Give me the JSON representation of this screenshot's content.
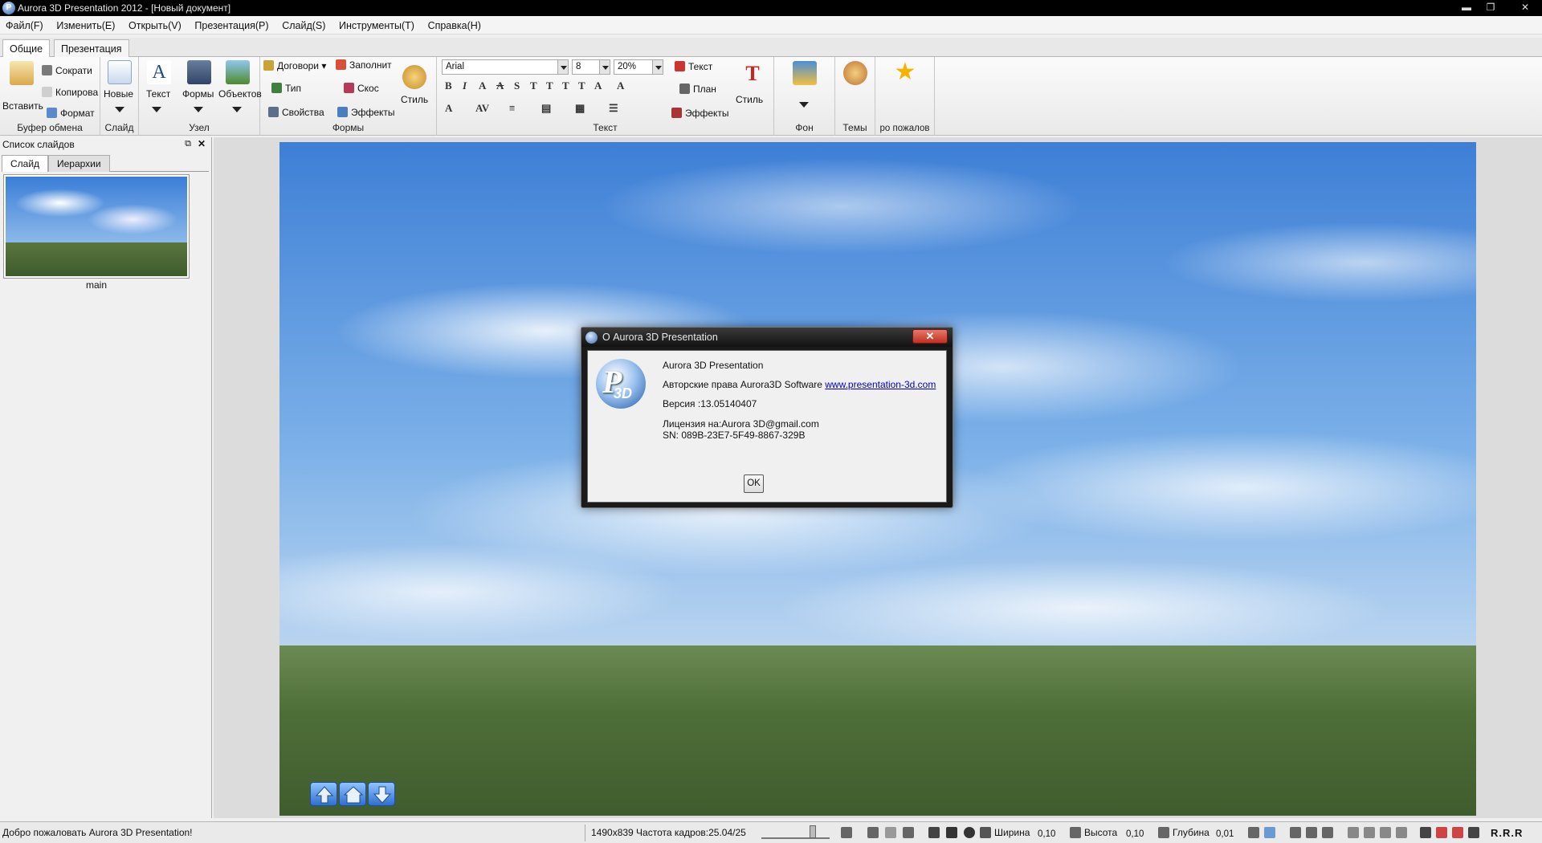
{
  "window": {
    "title": "Aurora 3D Presentation 2012 - [Новый документ]",
    "minimize": "▬",
    "restore": "❐",
    "close": "✕"
  },
  "menu": [
    "Файл(F)",
    "Изменить(E)",
    "Открыть(V)",
    "Презентация(P)",
    "Слайд(S)",
    "Инструменты(T)",
    "Справка(H)"
  ],
  "ribbon_tabs": [
    "Общие",
    "Презентация"
  ],
  "ribbon": {
    "clipboard": {
      "paste": "Вставить",
      "cut": "Сократи",
      "copy": "Копирова",
      "format": "Формат",
      "caption": "Буфер обмена"
    },
    "slide": {
      "new": "Новые",
      "caption": "Слайд"
    },
    "node": {
      "text": "Текст",
      "shapes": "Формы",
      "objects": "Объектов",
      "caption": "Узел"
    },
    "shapes": {
      "contract": "Договори",
      "fill": "Заполнит",
      "type": "Тип",
      "bevel": "Скос",
      "properties": "Свойства",
      "effects": "Эффекты",
      "style": "Стиль",
      "caption": "Формы"
    },
    "text": {
      "font": "Arial",
      "size": "8",
      "percent": "20%",
      "text_btn": "Текст",
      "plan_btn": "План",
      "effects_btn": "Эффекты",
      "style_btn": "Стиль",
      "caption": "Текст"
    },
    "background": {
      "caption": "Фон"
    },
    "themes": {
      "caption": "Темы"
    },
    "welcome": {
      "caption": "ро пожалов"
    }
  },
  "slides_panel": {
    "title": "Список слайдов",
    "tabs": [
      "Слайд",
      "Иерархии"
    ],
    "slides": [
      {
        "name": "main"
      }
    ]
  },
  "about_dialog": {
    "title": "О Aurora 3D Presentation",
    "product": "Aurora 3D Presentation",
    "copyright_prefix": "Авторские права Aurora3D Software ",
    "link": "www.presentation-3d.com",
    "version": "Версия :13.05140407",
    "license": "Лицензия на:Aurora 3D@gmail.com",
    "sn": "SN: 089B-23E7-5F49-8867-329B",
    "ok": "OK"
  },
  "status": {
    "message": "Добро пожаловать Aurora 3D Presentation!",
    "resolution_fps": "1490x839  Частота кадров:25.04/25",
    "width_label": "Ширина",
    "width_value": "0,10",
    "height_label": "Высота",
    "height_value": "0,10",
    "depth_label": "Глубина",
    "depth_value": "0,01",
    "right_marks": "R.R.R"
  },
  "colors": {
    "titlebar": "#000000",
    "sky": "#3e7fd6",
    "grass": "#4e6e38",
    "link": "#0000cc",
    "close_button": "#c2301f"
  }
}
